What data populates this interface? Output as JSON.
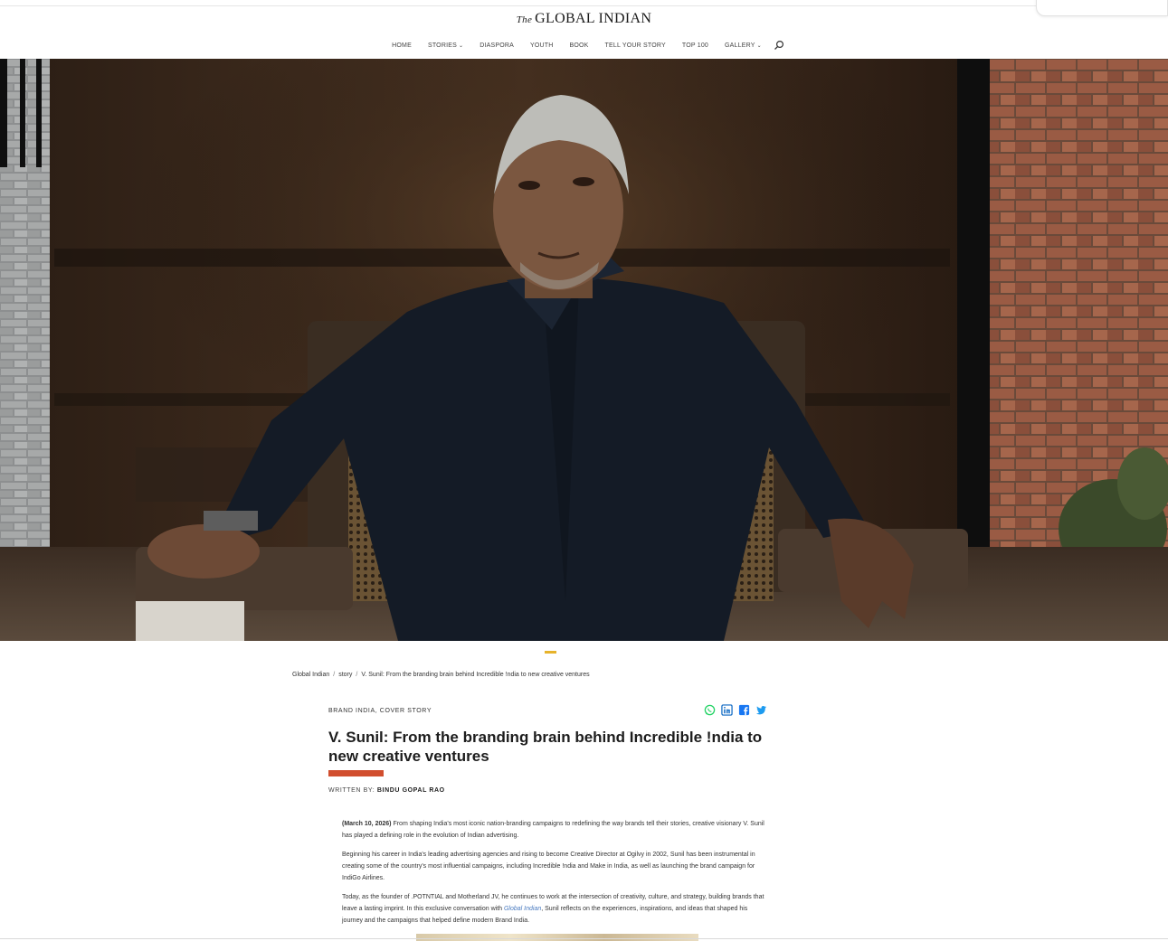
{
  "header": {
    "logo_the": "The",
    "logo_text": "GLOBAL INDIAN"
  },
  "nav": {
    "items": [
      {
        "label": "HOME",
        "has_dropdown": false
      },
      {
        "label": "STORIES",
        "has_dropdown": true
      },
      {
        "label": "DIASPORA",
        "has_dropdown": false
      },
      {
        "label": "YOUTH",
        "has_dropdown": false
      },
      {
        "label": "BOOK",
        "has_dropdown": false
      },
      {
        "label": "TELL YOUR STORY",
        "has_dropdown": false
      },
      {
        "label": "TOP 100",
        "has_dropdown": false
      },
      {
        "label": "GALLERY",
        "has_dropdown": true
      }
    ],
    "search_icon": "search-icon"
  },
  "hero": {
    "image_icon": "portrait-photo"
  },
  "breadcrumb": {
    "items": [
      "Global Indian",
      "story",
      "V. Sunil: From the branding brain behind Incredible !ndia to new creative ventures"
    ],
    "separator": "/"
  },
  "article": {
    "categories": "BRAND INDIA, COVER STORY",
    "title": "V. Sunil: From the branding brain behind Incredible !ndia to new creative ventures",
    "byline_prefix": "WRITTEN BY:",
    "author": "BINDU GOPAL RAO",
    "paragraphs": [
      {
        "date": "(March 10, 2026)",
        "text": "From shaping India's most iconic nation-branding campaigns to redefining the way brands tell their stories, creative visionary V. Sunil has played a defining role in the evolution of Indian advertising."
      },
      {
        "text": "Beginning his career in India's leading advertising agencies and rising to become Creative Director at Ogilvy in 2002, Sunil has been instrumental in creating some of the country's most influential campaigns, including Incredible !ndia and Make in India, as well as launching the brand campaign for IndiGo Airlines."
      },
      {
        "text_before": "Today, as the founder of .POTNTIAL and Motherland JV, he continues to work at the intersection of creativity, culture, and strategy, building brands that leave a lasting imprint. In this exclusive conversation with ",
        "link": "Global Indian",
        "text_after": ", Sunil reflects on the experiences, inspirations, and ideas that shaped his journey and the campaigns that helped define modern Brand India."
      }
    ]
  },
  "share": {
    "icons": [
      "whatsapp-icon",
      "linkedin-icon",
      "facebook-icon",
      "twitter-icon"
    ],
    "colors": {
      "whatsapp": "#25d366",
      "linkedin": "#0a66c2",
      "facebook": "#1877f2",
      "twitter": "#1d9bf0"
    }
  },
  "colors": {
    "accent_yellow": "#e7b32b",
    "title_underline": "#d14e2e",
    "link": "#4a7bc0"
  }
}
